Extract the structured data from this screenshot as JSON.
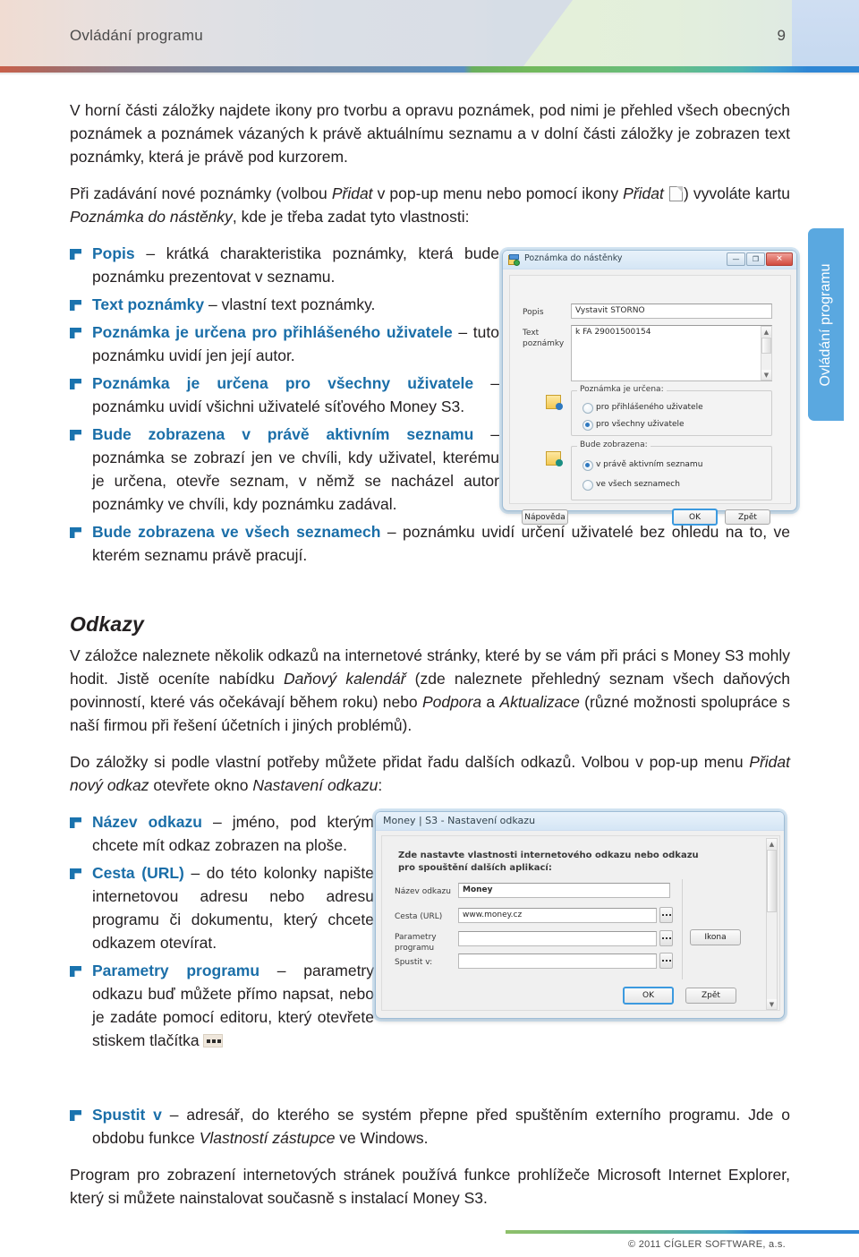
{
  "header": {
    "title": "Ovládání programu",
    "page_number": "9"
  },
  "side_tab": {
    "label": "Ovládání programu"
  },
  "body": {
    "intro_paragraph": "V horní části záložky najdete ikony pro tvorbu a opravu poznámek, pod nimi je přehled všech obecných poznámek a poznámek vázaných k právě aktuálnímu seznamu a v dolní části záložky je zobrazen text poznámky, která je právě pod kurzorem.",
    "p2_a": "Při zadávání nové poznámky (volbou ",
    "p2_b": "Přidat",
    "p2_c": " v pop-up menu nebo pomocí ikony ",
    "p2_d": "Přidat",
    "p2_e": ") vyvoláte kartu ",
    "p2_f": "Poznámka do nástěnky",
    "p2_g": ", kde je třeba zadat tyto vlastnosti:",
    "bullets": [
      {
        "term": "Popis",
        "rest": " – krátká charakteristika poznámky, která bude poznámku prezentovat v seznamu."
      },
      {
        "term": "Text poznámky",
        "rest": " – vlastní text poznámky."
      },
      {
        "term": "Poznámka je určena pro přihlášeného uživatele",
        "rest": " – tuto poznámku uvidí jen její autor."
      },
      {
        "term": "Poznámka je určena pro všechny uživatele",
        "rest": " – poznámku uvidí všichni uživatelé síťového Money S3."
      },
      {
        "term": "Bude zobrazena v právě aktivním seznamu",
        "rest": " – poznámka se zobrazí jen ve chvíli, kdy uživatel, kterému je určena, otevře seznam, v němž se nacházel autor poznámky ve chvíli, kdy poznámku zadával."
      },
      {
        "term": "Bude zobrazena ve všech seznamech",
        "rest": " – poznámku uvidí určení uživatelé bez ohledu na to, ve kterém seznamu právě pracují."
      }
    ],
    "section_odkazy": {
      "heading": "Odkazy",
      "p1_a": "V záložce naleznete několik odkazů na internetové stránky, které by se vám při práci s Money S3 mohly hodit. Jistě oceníte nabídku ",
      "p1_b": "Daňový kalendář",
      "p1_c": " (zde naleznete přehledný seznam všech daňových povinností, které vás očekávají během roku) nebo ",
      "p1_d": "Podpora",
      "p1_e": " a ",
      "p1_f": "Aktualizace",
      "p1_g": " (různé možnosti spolupráce s naší firmou při řešení účetních i jiných problémů).",
      "p2_a": "Do záložky si podle vlastní potřeby můžete přidat řadu dalších odkazů. Volbou v pop-up menu ",
      "p2_b": "Přidat nový odkaz",
      "p2_c": " otevřete okno ",
      "p2_d": "Nastavení odkazu",
      "p2_e": ":",
      "bullets": [
        {
          "term": "Název odkazu",
          "rest": " – jméno, pod kterým chcete mít odkaz zobrazen na ploše."
        },
        {
          "term": "Cesta (URL)",
          "rest": " – do této kolonky napište internetovou adresu nebo adresu programu či dokumentu, který chcete odkazem otevírat."
        },
        {
          "term": "Parametry programu",
          "rest": " – parametry odkazu buď můžete přímo napsat, nebo je zadáte pomocí editoru, který otevřete stiskem tlačítka "
        }
      ],
      "bullet_spustit": {
        "term": "Spustit v",
        "rest_a": " – adresář, do kterého se systém přepne před spuštěním externího programu. Jde o obdobu funkce ",
        "rest_b": "Vlastností zástupce",
        "rest_c": " ve Windows."
      },
      "closing_paragraph": "Program pro zobrazení internetových stránek používá funkce prohlížeče Microsoft Internet Explorer, který si můžete nainstalovat současně s instalací Money S3."
    }
  },
  "dialog_note": {
    "title": "Poznámka do nástěnky",
    "win_minimize": "—",
    "win_maximize": "❐",
    "win_close": "✕",
    "label_popis": "Popis",
    "value_popis": "Vystavit STORNO",
    "label_text": "Text",
    "label_text2": "poznámky",
    "value_text": "k FA 29001500154",
    "group_urceni": "Poznámka je určena:",
    "radio_prihlaseny": "pro přihlášeného uživatele",
    "radio_vsichni": "pro všechny uživatele",
    "group_zobrazena": "Bude zobrazena:",
    "radio_aktivni": "v právě aktivním seznamu",
    "radio_vsechny": "ve všech seznamech",
    "btn_napoveda": "Nápověda",
    "btn_ok": "OK",
    "btn_zpet": "Zpět"
  },
  "dialog_link": {
    "title": "Money | S3 - Nastavení odkazu",
    "intro_line1": "Zde nastavte vlastnosti internetového odkazu nebo odkazu",
    "intro_line2": "pro spouštění dalších aplikací:",
    "label_nazev": "Název odkazu",
    "value_nazev": "Money",
    "label_cesta": "Cesta (URL)",
    "value_cesta": "www.money.cz",
    "label_parametry1": "Parametry",
    "label_parametry2": "programu",
    "value_parametry": "",
    "label_spustit": "Spustit v:",
    "value_spustit": "",
    "btn_ikona": "Ikona",
    "btn_ok": "OK",
    "btn_zpet": "Zpět",
    "browse_label": "..."
  },
  "footer": {
    "copyright": "© 2011 CÍGLER SOFTWARE, a.s."
  },
  "colors": {
    "accent_blue": "#1a6ea8",
    "marker_blue": "#1a73ae",
    "tab_blue": "#5aa8e0",
    "text": "#231f20"
  }
}
